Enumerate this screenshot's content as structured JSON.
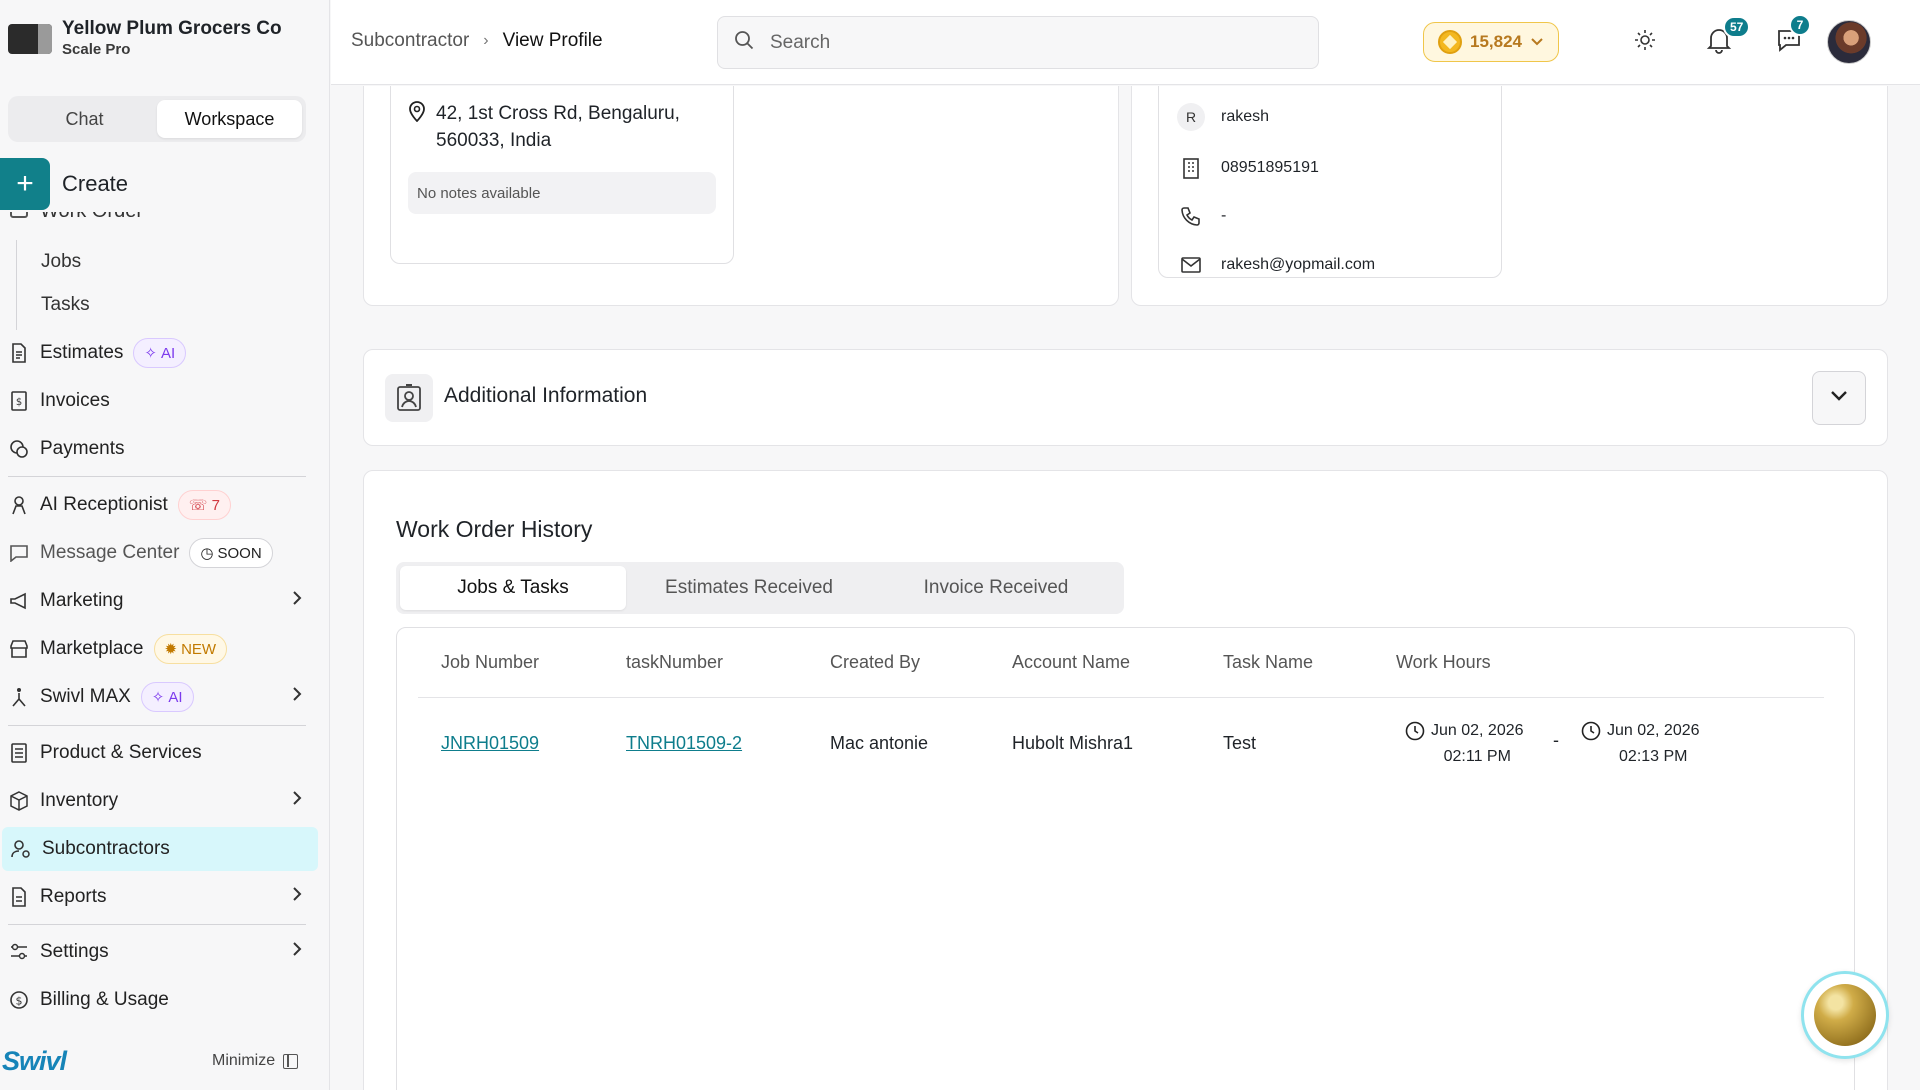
{
  "brand": {
    "name": "Yellow Plum Grocers Co",
    "plan": "Scale Pro"
  },
  "mode_toggle": {
    "chat": "Chat",
    "workspace": "Workspace",
    "active": "Workspace"
  },
  "create": {
    "label": "Create"
  },
  "sidebar": {
    "clipped_item": "Work Order",
    "work_order_sub": [
      "Jobs",
      "Tasks"
    ],
    "estimates": {
      "label": "Estimates",
      "badge": "AI"
    },
    "invoices": {
      "label": "Invoices"
    },
    "payments": {
      "label": "Payments"
    },
    "ai_receptionist": {
      "label": "AI Receptionist",
      "badge": "7"
    },
    "message_center": {
      "label": "Message Center",
      "badge": "SOON"
    },
    "marketing": {
      "label": "Marketing"
    },
    "marketplace": {
      "label": "Marketplace",
      "badge": "NEW"
    },
    "swivl_max": {
      "label": "Swivl MAX",
      "badge": "AI"
    },
    "product_services": {
      "label": "Product & Services"
    },
    "inventory": {
      "label": "Inventory"
    },
    "subcontractors": {
      "label": "Subcontractors",
      "active": true
    },
    "reports": {
      "label": "Reports"
    },
    "settings": {
      "label": "Settings"
    },
    "billing": {
      "label": "Billing & Usage"
    }
  },
  "footer": {
    "logo": "Swivl",
    "minimize": "Minimize"
  },
  "header": {
    "breadcrumb": [
      "Subcontractor",
      "View Profile"
    ],
    "search_placeholder": "Search",
    "credits": "15,824",
    "notifications_count": "57",
    "messages_count": "7"
  },
  "profile": {
    "address_line1": "42, 1st Cross Rd, Bengaluru,",
    "address_line2": "560033, India",
    "notes": "No notes available",
    "contact": {
      "initial": "R",
      "name": "rakesh",
      "office_phone": "08951895191",
      "mobile": "-",
      "email": "rakesh@yopmail.com"
    }
  },
  "additional_info": {
    "title": "Additional Information"
  },
  "work_order_history": {
    "title": "Work Order History",
    "tabs": [
      "Jobs & Tasks",
      "Estimates Received",
      "Invoice Received"
    ],
    "active_tab": "Jobs & Tasks",
    "columns": [
      "Job Number",
      "taskNumber",
      "Created By",
      "Account Name",
      "Task Name",
      "Work Hours"
    ],
    "rows": [
      {
        "job_number": "JNRH01509",
        "task_number": "TNRH01509-2",
        "created_by": "Mac antonie",
        "account_name": "Hubolt Mishra1",
        "task_name": "Test",
        "start_date": "Jun 02, 2026",
        "start_time": "02:11 PM",
        "separator": "-",
        "end_date": "Jun 02, 2026",
        "end_time": "02:13 PM"
      }
    ]
  },
  "colors": {
    "accent": "#11808a",
    "active_nav": "#d7f7fb",
    "link": "#0e7d8c",
    "credits": "#b7791f"
  }
}
